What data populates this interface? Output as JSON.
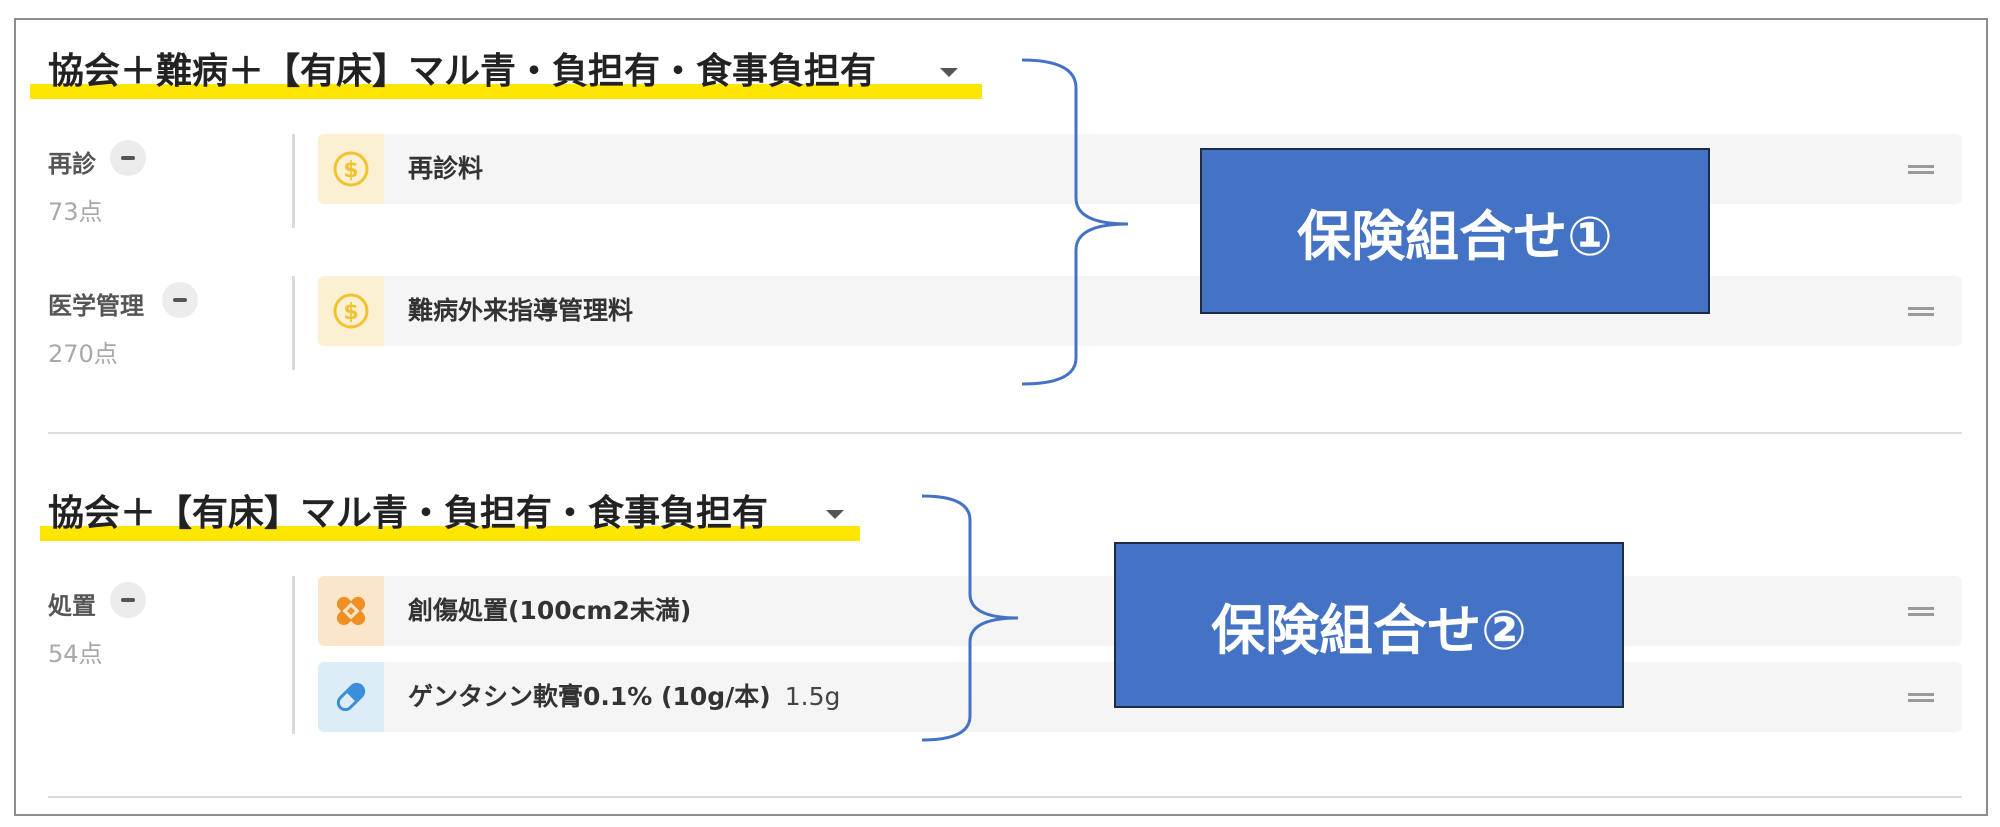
{
  "groups": [
    {
      "title": "協会＋難病＋【有床】マル青・負担有・食事負担有",
      "categories": [
        {
          "label": "再診",
          "points": "73点",
          "rows": [
            {
              "icon": "dollar-coin-icon",
              "text": "再診料"
            }
          ]
        },
        {
          "label": "医学管理",
          "points": "270点",
          "rows": [
            {
              "icon": "dollar-coin-icon",
              "text": "難病外来指導管理料"
            }
          ]
        }
      ],
      "annotation": "保険組合せ①"
    },
    {
      "title": "協会＋【有床】マル青・負担有・食事負担有",
      "categories": [
        {
          "label": "処置",
          "points": "54点",
          "rows": [
            {
              "icon": "bandage-icon",
              "text": "創傷処置(100cm2未満)"
            },
            {
              "icon": "pill-icon",
              "text": "ゲンタシン軟膏0.1% (10g/本)",
              "qty": "1.5g"
            }
          ]
        }
      ],
      "annotation": "保険組合せ②"
    }
  ],
  "colors": {
    "highlight": "#ffe600",
    "callout": "#4472c4",
    "brace": "#4472c4",
    "coin": "#f2c230",
    "bandage": "#ef8f24",
    "pill": "#3b8fd9"
  }
}
